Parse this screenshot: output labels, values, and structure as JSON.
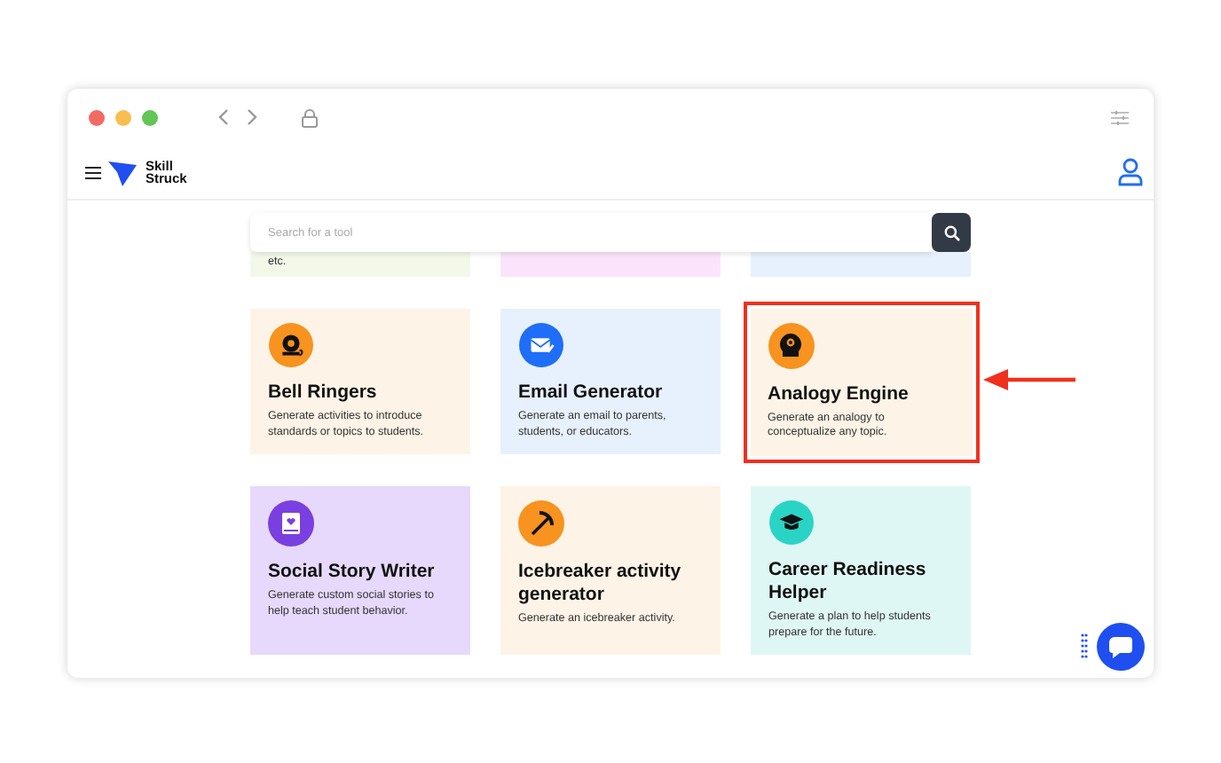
{
  "header": {
    "logo_text": "Skill Struck"
  },
  "search": {
    "placeholder": "Search for a tool"
  },
  "cards": [
    {
      "kind": "partial",
      "description": "etc.",
      "color": "#f4f8e9",
      "highlighted": false
    },
    {
      "kind": "partial",
      "color": "#fbe4fb",
      "highlighted": false
    },
    {
      "kind": "partial",
      "color": "#e7f0fd",
      "highlighted": false
    },
    {
      "kind": "bell",
      "title": "Bell Ringers",
      "description": "Generate activities to introduce standards or topics to students.",
      "color": "#fdf3e6",
      "highlighted": false
    },
    {
      "kind": "email",
      "title": "Email Generator",
      "description": "Generate an email to parents, students, or educators.",
      "color": "#e7f0fd",
      "highlighted": false
    },
    {
      "kind": "head",
      "title": "Analogy Engine",
      "description": "Generate an analogy to conceptualize any topic.",
      "color": "#fdf3e6",
      "highlighted": true
    },
    {
      "kind": "book",
      "title": "Social Story Writer",
      "description": "Generate custom social stories to help teach student behavior.",
      "color": "#e6d9fb",
      "highlighted": false
    },
    {
      "kind": "pickaxe",
      "title": "Icebreaker activity generator",
      "description": "Generate an icebreaker activity.",
      "color": "#fdf3e6",
      "highlighted": false
    },
    {
      "kind": "cap",
      "title": "Career Readiness Helper",
      "description": "Generate a plan to help students prepare for the future.",
      "color": "#def7f5",
      "highlighted": false
    }
  ]
}
